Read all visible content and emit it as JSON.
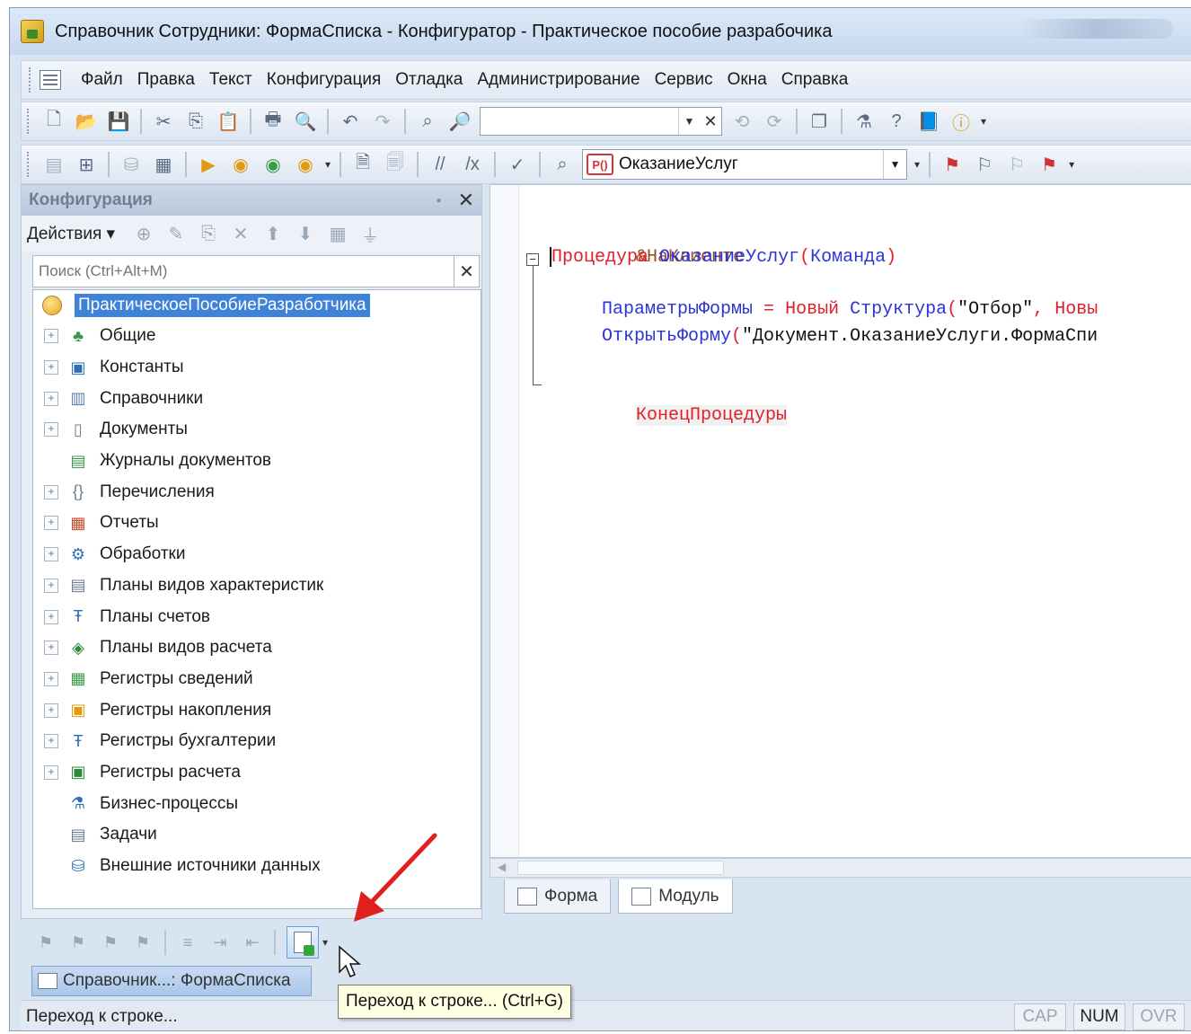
{
  "title": "Справочник Сотрудники: ФормаСписка - Конфигуратор - Практическое пособие разрабочика",
  "menu": [
    "Файл",
    "Правка",
    "Текст",
    "Конфигурация",
    "Отладка",
    "Администрирование",
    "Сервис",
    "Окна",
    "Справка"
  ],
  "toolbar": {
    "search_value": "",
    "procedure_badge": "P()",
    "procedure_value": "ОказаниеУслуг"
  },
  "config_panel": {
    "title": "Конфигурация",
    "actions_label": "Действия ▾",
    "search_placeholder": "Поиск (Ctrl+Alt+M)",
    "root": "ПрактическоеПособиеРазработчика",
    "items": [
      {
        "label": "Общие",
        "icon": "common-icon",
        "expandable": true
      },
      {
        "label": "Константы",
        "icon": "constants-icon",
        "expandable": true
      },
      {
        "label": "Справочники",
        "icon": "catalogs-icon",
        "expandable": true
      },
      {
        "label": "Документы",
        "icon": "documents-icon",
        "expandable": true
      },
      {
        "label": "Журналы документов",
        "icon": "journals-icon",
        "expandable": false
      },
      {
        "label": "Перечисления",
        "icon": "enums-icon",
        "expandable": true
      },
      {
        "label": "Отчеты",
        "icon": "reports-icon",
        "expandable": true
      },
      {
        "label": "Обработки",
        "icon": "processing-icon",
        "expandable": true
      },
      {
        "label": "Планы видов характеристик",
        "icon": "characteristic-types-icon",
        "expandable": true
      },
      {
        "label": "Планы счетов",
        "icon": "chart-of-accounts-icon",
        "expandable": true
      },
      {
        "label": "Планы видов расчета",
        "icon": "calculation-types-icon",
        "expandable": true
      },
      {
        "label": "Регистры сведений",
        "icon": "info-registers-icon",
        "expandable": true
      },
      {
        "label": "Регистры накопления",
        "icon": "accumulation-registers-icon",
        "expandable": true
      },
      {
        "label": "Регистры бухгалтерии",
        "icon": "accounting-registers-icon",
        "expandable": true
      },
      {
        "label": "Регистры расчета",
        "icon": "calculation-registers-icon",
        "expandable": true
      },
      {
        "label": "Бизнес-процессы",
        "icon": "business-processes-icon",
        "expandable": false
      },
      {
        "label": "Задачи",
        "icon": "tasks-icon",
        "expandable": false
      },
      {
        "label": "Внешние источники данных",
        "icon": "external-sources-icon",
        "expandable": false
      }
    ]
  },
  "code": {
    "directive": "&НаКлиенте",
    "proc_keyword": "Процедура",
    "proc_name": "ОказаниеУслуг",
    "proc_param": "Команда",
    "line1_var": "ПараметрыФормы",
    "line1_op": "=",
    "line1_new": "Новый",
    "line1_type": "Структура",
    "line1_str": "\"Отбор\"",
    "line1_tail": "Новы",
    "line2_func": "ОткрытьФорму",
    "line2_str": "\"Документ.ОказаниеУслуги.ФормаСпи",
    "end_keyword": "КонецПроцедуры"
  },
  "editor_tabs": [
    "Форма",
    "Модуль"
  ],
  "window_tab": "Справочник...: ФормаСписка",
  "tooltip": "Переход к строке... (Ctrl+G)",
  "status": {
    "text": "Переход к строке...",
    "indicators": [
      {
        "label": "CAP",
        "active": false
      },
      {
        "label": "NUM",
        "active": true
      },
      {
        "label": "OVR",
        "active": false
      }
    ]
  }
}
